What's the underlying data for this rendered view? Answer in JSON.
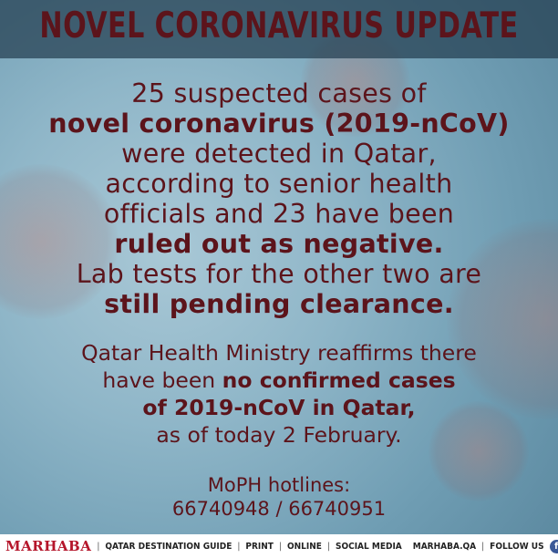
{
  "header": {
    "title": "NOVEL CORONAVIRUS UPDATE"
  },
  "main": {
    "line1": "25 suspected cases of",
    "line2": "novel coronavirus (2019-nCoV)",
    "line3": "were detected in Qatar,",
    "line4": "according to senior health",
    "line5": "officials and 23 have been",
    "line6": "ruled out as negative.",
    "line7": "Lab tests for the other two are",
    "line8": "still pending clearance."
  },
  "ministry": {
    "line1": "Qatar Health Ministry reaffirms there",
    "line2_prefix": "have been ",
    "line2_bold": "no confirmed cases",
    "line3": "of 2019-nCoV in Qatar,",
    "line4": "as of today 2 February."
  },
  "hotlines": {
    "label": "MoPH hotlines:",
    "numbers": "66740948 / 66740951"
  },
  "footer": {
    "brand": "MARHABA",
    "item1": "QATAR DESTINATION GUIDE",
    "item2": "PRINT",
    "item3": "ONLINE",
    "item4": "SOCIAL MEDIA",
    "site": "MARHABA.QA",
    "follow": "FOLLOW US",
    "icons": [
      "facebook-icon",
      "twitter-icon",
      "instagram-icon"
    ],
    "sep": "|"
  },
  "colors": {
    "text": "#5c141b",
    "brand": "#b5162b"
  }
}
